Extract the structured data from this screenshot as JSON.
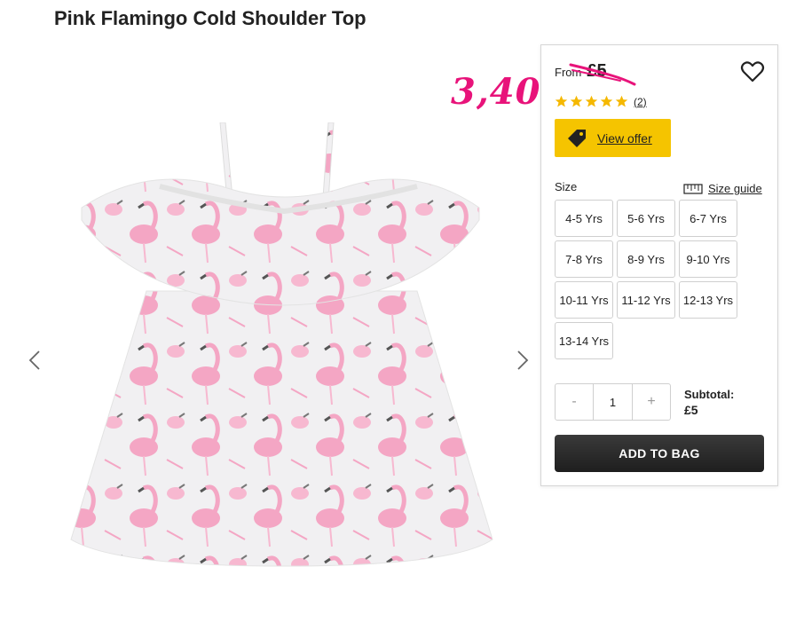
{
  "product": {
    "title": "Pink Flamingo Cold Shoulder Top",
    "image_alt_icon": "flamingo-top-image"
  },
  "annotation": {
    "handwritten_price": "3,40",
    "color": "#e8137a"
  },
  "price": {
    "from_label": "From",
    "old_price": "£5"
  },
  "rating": {
    "stars": 5,
    "max_stars": 5,
    "review_count": "(2)",
    "star_color": "#f5b800"
  },
  "offer": {
    "label": "View offer",
    "color": "#f5c400"
  },
  "size": {
    "label": "Size",
    "guide_label": "Size guide",
    "options": [
      "4-5 Yrs",
      "5-6 Yrs",
      "6-7 Yrs",
      "7-8 Yrs",
      "8-9 Yrs",
      "9-10 Yrs",
      "10-11 Yrs",
      "11-12 Yrs",
      "12-13 Yrs",
      "13-14 Yrs"
    ]
  },
  "quantity": {
    "minus": "-",
    "value": "1",
    "plus": "+"
  },
  "subtotal": {
    "label": "Subtotal:",
    "value": "£5"
  },
  "actions": {
    "add_to_bag": "ADD TO BAG"
  },
  "icons": {
    "prev": "chevron-left-icon",
    "next": "chevron-right-icon",
    "wishlist": "heart-icon",
    "offer": "tag-icon",
    "size_guide": "ruler-icon",
    "star": "star-icon"
  }
}
